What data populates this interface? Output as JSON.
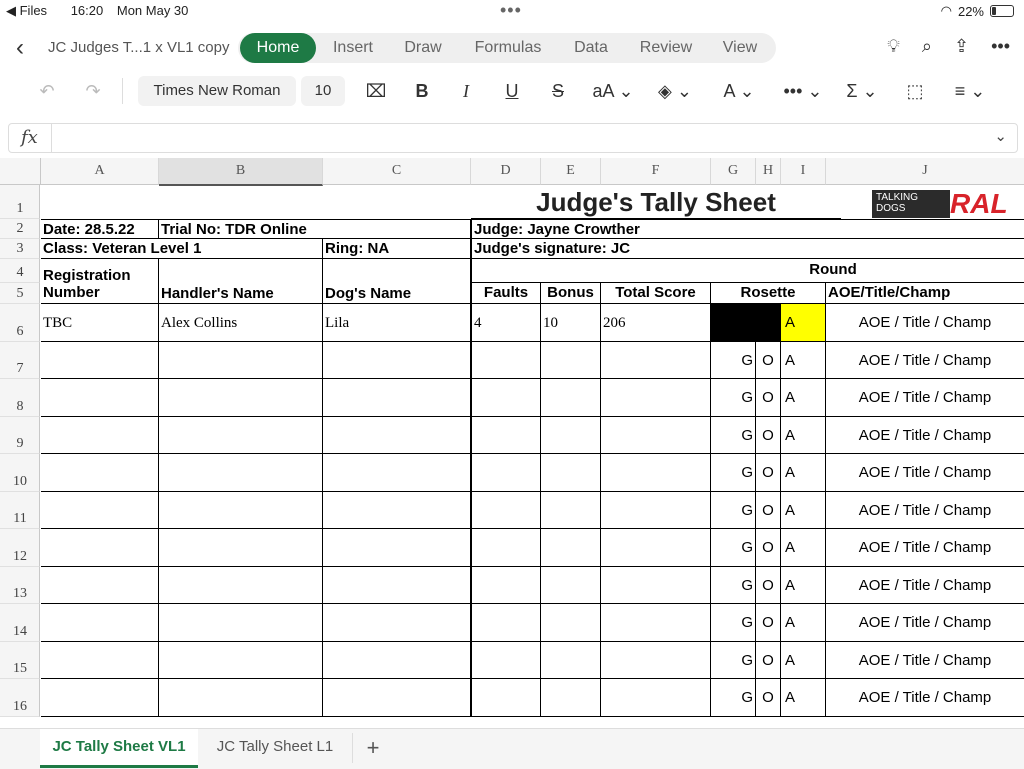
{
  "status": {
    "back_app": "Files",
    "time": "16:20",
    "date": "Mon May 30",
    "battery": "22%"
  },
  "doc": {
    "title": "JC Judges T...1 x VL1 copy"
  },
  "tabs": [
    "Home",
    "Insert",
    "Draw",
    "Formulas",
    "Data",
    "Review",
    "View"
  ],
  "toolbar": {
    "font": "Times New Roman",
    "size": "10"
  },
  "columns": [
    "A",
    "B",
    "C",
    "D",
    "E",
    "F",
    "G",
    "H",
    "I",
    "J"
  ],
  "rows": [
    "1",
    "2",
    "3",
    "4",
    "5",
    "6",
    "7",
    "8",
    "9",
    "10",
    "11",
    "12",
    "13",
    "14",
    "15",
    "16"
  ],
  "sheet": {
    "title": "Judge's Tally Sheet",
    "logo_left": "TALKING DOGS",
    "logo_right": "RAL",
    "date": "Date: 28.5.22",
    "trial": "Trial No: TDR Online",
    "judge": "Judge: Jayne Crowther",
    "class": "Class: Veteran Level 1",
    "ring": "Ring: NA",
    "signature": "Judge's signature: JC",
    "round": "Round",
    "hdr_reg1": "Registration",
    "hdr_reg2": "Number",
    "hdr_handler": "Handler's Name",
    "hdr_dog": "Dog's Name",
    "hdr_faults": "Faults",
    "hdr_bonus": "Bonus",
    "hdr_total": "Total Score",
    "hdr_rosette": "Rosette",
    "hdr_aoe": "AOE/Title/Champ",
    "data_row": {
      "reg": "TBC",
      "handler": "Alex Collins",
      "dog": "Lila",
      "faults": "4",
      "bonus": "10",
      "total": "206",
      "rosette": "A",
      "aoe": "AOE / Title / Champ"
    },
    "rosette_g": "G",
    "rosette_o": "O",
    "rosette_a": "A",
    "aoe_text": "AOE / Title / Champ"
  },
  "sheets": [
    "JC Tally Sheet VL1",
    "JC Tally Sheet L1"
  ]
}
